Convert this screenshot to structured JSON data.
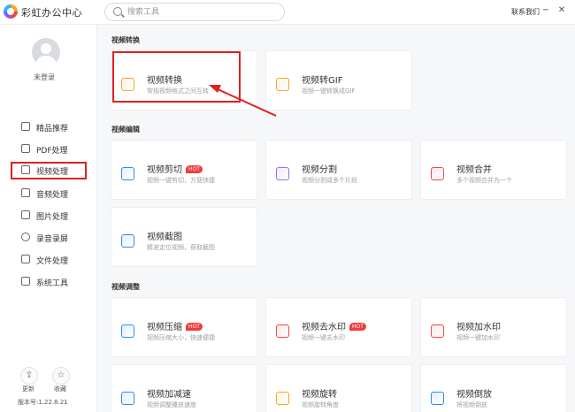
{
  "app": {
    "title": "彩虹办公中心"
  },
  "search": {
    "placeholder": "搜索工具"
  },
  "header": {
    "contact": "联系我们",
    "minimize": "−",
    "close": "✕"
  },
  "user": {
    "login": "未登录"
  },
  "sidebar": {
    "items": [
      {
        "label": "精品推荐",
        "icon": "thumb-up-icon"
      },
      {
        "label": "PDF处理",
        "icon": "pdf-icon"
      },
      {
        "label": "视频处理",
        "icon": "video-icon",
        "active": true
      },
      {
        "label": "音频处理",
        "icon": "music-icon"
      },
      {
        "label": "图片处理",
        "icon": "image-icon"
      },
      {
        "label": "录音录屏",
        "icon": "record-icon"
      },
      {
        "label": "文件处理",
        "icon": "folder-icon"
      },
      {
        "label": "系统工具",
        "icon": "system-icon"
      }
    ],
    "update": "更新",
    "favorite": "收藏",
    "version": "版本号:1.22.8.21"
  },
  "sections": [
    {
      "title": "视频转换"
    },
    {
      "title": "视频编辑"
    },
    {
      "title": "视频调整"
    }
  ],
  "cards": [
    {
      "title": "视频转换",
      "desc": "常规视频格式之间互转",
      "hot": "",
      "color": "#f5a623"
    },
    {
      "title": "视频转GIF",
      "desc": "视频一键转换成GIF",
      "hot": "",
      "color": "#f5a623"
    },
    {
      "title": "视频剪切",
      "desc": "视频一键剪切，方便快捷",
      "hot": "HOT",
      "color": "#2d8cf0"
    },
    {
      "title": "视频分割",
      "desc": "视频分割成多个片段",
      "hot": "",
      "color": "#9b6cf2"
    },
    {
      "title": "视频合并",
      "desc": "多个视频合并为一个",
      "hot": "",
      "color": "#f04a4a"
    },
    {
      "title": "视频截图",
      "desc": "精准定位视频，获取截图",
      "hot": "",
      "color": "#2d8cf0"
    },
    {
      "title": "视频压缩",
      "desc": "视频压缩大小，快速便捷",
      "hot": "HOT",
      "color": "#2d8cf0"
    },
    {
      "title": "视频去水印",
      "desc": "视频一键去水印",
      "hot": "HOT",
      "color": "#f04a4a"
    },
    {
      "title": "视频加水印",
      "desc": "视频一键加水印",
      "hot": "",
      "color": "#f04a4a"
    },
    {
      "title": "视频加减速",
      "desc": "视频调整播放速度",
      "hot": "",
      "color": "#2d8cf0"
    },
    {
      "title": "视频旋转",
      "desc": "视频旋转角度",
      "hot": "",
      "color": "#f5a623"
    },
    {
      "title": "视频倒放",
      "desc": "将视频倒放",
      "hot": "",
      "color": "#2d8cf0"
    }
  ]
}
